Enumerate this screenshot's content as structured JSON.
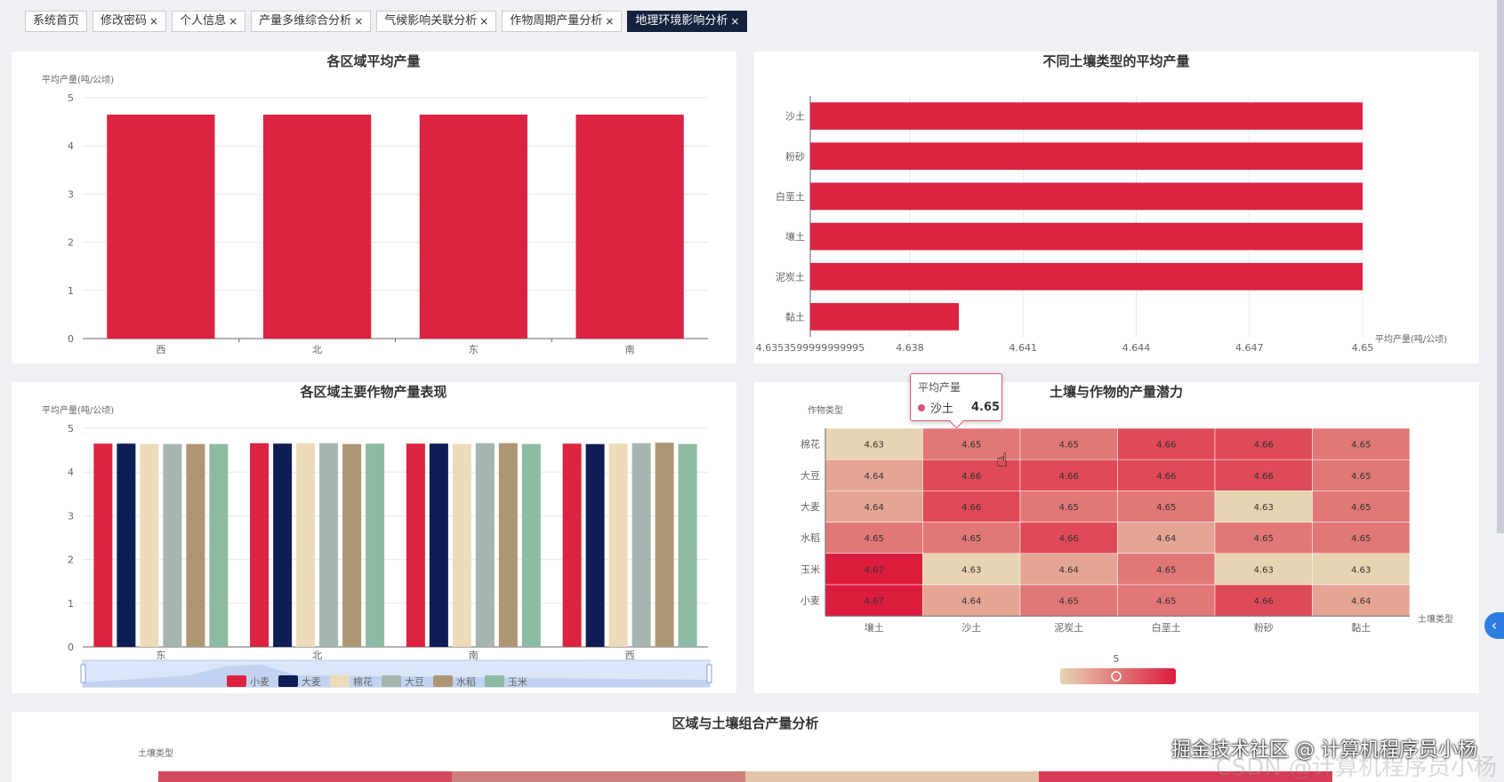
{
  "tabs": [
    {
      "label": "系统首页",
      "closable": false,
      "active": false
    },
    {
      "label": "修改密码",
      "closable": true,
      "active": false
    },
    {
      "label": "个人信息",
      "closable": true,
      "active": false
    },
    {
      "label": "产量多维综合分析",
      "closable": true,
      "active": false
    },
    {
      "label": "气候影响关联分析",
      "closable": true,
      "active": false
    },
    {
      "label": "作物周期产量分析",
      "closable": true,
      "active": false
    },
    {
      "label": "地理环境影响分析",
      "closable": true,
      "active": true
    }
  ],
  "close_glyph": "×",
  "colors": {
    "red": "#dc2342",
    "navy": "#0e1e54",
    "cream": "#ecdcba",
    "gray": "#a4b6ad",
    "tan": "#ae9674",
    "green": "#8dbaa2"
  },
  "chart_data": [
    {
      "id": "region-avg",
      "type": "bar",
      "title": "各区域平均产量",
      "ylabel": "平均产量(吨/公顷)",
      "categories": [
        "西",
        "北",
        "东",
        "南"
      ],
      "values": [
        4.65,
        4.65,
        4.65,
        4.65
      ],
      "ylim": [
        0,
        5
      ],
      "yticks": [
        "0",
        "1",
        "2",
        "3",
        "4",
        "5"
      ],
      "grid": true
    },
    {
      "id": "soil-avg",
      "type": "bar",
      "orientation": "horizontal",
      "title": "不同土壤类型的平均产量",
      "xlabel": "平均产量(吨/公顷)",
      "categories": [
        "沙土",
        "粉砂",
        "白垩土",
        "壤土",
        "泥炭土",
        "黏土"
      ],
      "values": [
        4.65,
        4.65,
        4.65,
        4.65,
        4.65,
        4.6393
      ],
      "xlim": [
        4.6353599999999995,
        4.65
      ],
      "xticks": [
        "4.6353599999999995",
        "4.638",
        "4.641",
        "4.644",
        "4.647",
        "4.65"
      ],
      "grid": true
    },
    {
      "id": "region-crop",
      "type": "bar",
      "title": "各区域主要作物产量表现",
      "ylabel": "平均产量(吨/公顷)",
      "categories": [
        "东",
        "北",
        "南",
        "西"
      ],
      "ylim": [
        0,
        5
      ],
      "yticks": [
        "0",
        "1",
        "2",
        "3",
        "4",
        "5"
      ],
      "legend_position": "bottom",
      "series": [
        {
          "name": "小麦",
          "values": [
            4.65,
            4.66,
            4.65,
            4.65
          ]
        },
        {
          "name": "大麦",
          "values": [
            4.65,
            4.65,
            4.65,
            4.64
          ]
        },
        {
          "name": "棉花",
          "values": [
            4.64,
            4.66,
            4.64,
            4.65
          ]
        },
        {
          "name": "大豆",
          "values": [
            4.64,
            4.66,
            4.66,
            4.66
          ]
        },
        {
          "name": "水稻",
          "values": [
            4.64,
            4.64,
            4.66,
            4.67
          ]
        },
        {
          "name": "玉米",
          "values": [
            4.64,
            4.65,
            4.64,
            4.64
          ]
        }
      ]
    },
    {
      "id": "soil-crop",
      "type": "heatmap",
      "title": "土壤与作物的产量潜力",
      "ylabel": "作物类型",
      "xlabel": "土壤类型",
      "x": [
        "壤土",
        "沙土",
        "泥炭土",
        "白垩土",
        "粉砂",
        "黏土"
      ],
      "y": [
        "棉花",
        "大豆",
        "大麦",
        "水稻",
        "玉米",
        "小麦"
      ],
      "values": [
        [
          4.63,
          4.65,
          4.65,
          4.66,
          4.66,
          4.65
        ],
        [
          4.64,
          4.66,
          4.66,
          4.66,
          4.66,
          4.65
        ],
        [
          4.64,
          4.66,
          4.65,
          4.65,
          4.63,
          4.65
        ],
        [
          4.65,
          4.65,
          4.66,
          4.64,
          4.65,
          4.65
        ],
        [
          4.67,
          4.63,
          4.64,
          4.65,
          4.63,
          4.63
        ],
        [
          4.67,
          4.64,
          4.65,
          4.65,
          4.66,
          4.64
        ]
      ],
      "visual_map_label": "5"
    },
    {
      "id": "region-soil",
      "type": "heatmap",
      "title": "区域与土壤组合产量分析",
      "ylabel": "土壤类型"
    }
  ],
  "tooltip": {
    "title": "平均产量",
    "series": "沙土",
    "value": "4.65"
  },
  "watermark": "掘金技术社区 @ 计算机程序员小杨",
  "watermark_ghost": "CSDN @计算机程序员小杨"
}
